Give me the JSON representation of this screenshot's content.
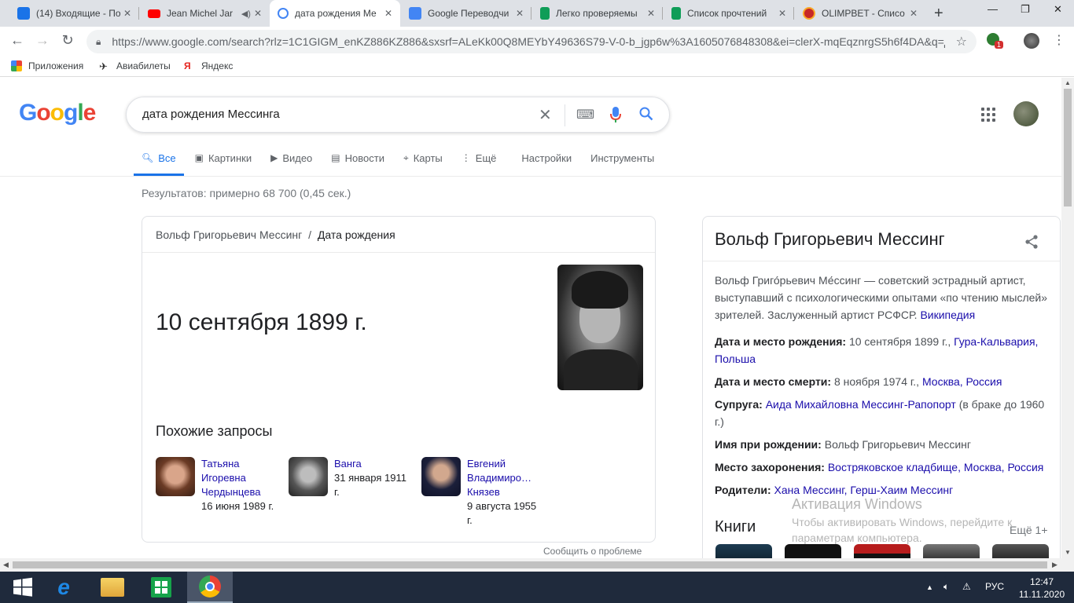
{
  "browser": {
    "tabs": [
      {
        "title": "(14) Входящие - По",
        "icon": "mail-icon",
        "color": "#1a73e8"
      },
      {
        "title": "Jean Michel Jar",
        "icon": "youtube-icon",
        "color": "#ff0000"
      },
      {
        "title": "дата рождения Ме",
        "icon": "google-icon",
        "color": "#4285f4"
      },
      {
        "title": "Google Переводчи",
        "icon": "translate-icon",
        "color": "#4285f4"
      },
      {
        "title": "Легко проверяемы",
        "icon": "sheets-icon",
        "color": "#0f9d58"
      },
      {
        "title": "Список прочтений",
        "icon": "sheets-icon",
        "color": "#0f9d58"
      },
      {
        "title": "OLIMPBET - Списо",
        "icon": "olimpbet-icon",
        "color": "#c62828"
      }
    ],
    "url": "https://www.google.com/search?rlz=1C1GIGM_enKZ886KZ886&sxsrf=ALeKk00Q8MEYbY49636S79-V-0-b_jgp6w%3A1605076848308&ei=clerX-mqEqznrgS5h6f4DA&q=д...",
    "extension_badge": "1",
    "bookmarks": [
      {
        "label": "Приложения",
        "icon": "apps-grid-icon"
      },
      {
        "label": "Авиабилеты",
        "icon": "airplane-icon"
      },
      {
        "label": "Яндекс",
        "icon": "yandex-icon"
      }
    ]
  },
  "google": {
    "logo": "Google",
    "query": "дата рождения Мессинга",
    "tabs": [
      {
        "label": "Все",
        "icon": "search-icon",
        "active": true
      },
      {
        "label": "Картинки",
        "icon": "image-icon"
      },
      {
        "label": "Видео",
        "icon": "video-icon"
      },
      {
        "label": "Новости",
        "icon": "news-icon"
      },
      {
        "label": "Карты",
        "icon": "map-pin-icon"
      },
      {
        "label": "Ещё",
        "icon": "more-vert-icon"
      },
      {
        "label": "Настройки"
      },
      {
        "label": "Инструменты"
      }
    ],
    "result_stats": "Результатов: примерно 68 700 (0,45 сек.)"
  },
  "featured": {
    "crumb_entity": "Вольф Григорьевич Мессинг",
    "crumb_sep": "/",
    "crumb_attr": "Дата рождения",
    "answer": "10 сентября 1899 г.",
    "related_title": "Похожие запросы",
    "related": [
      {
        "name": "Татьяна Игоревна Чердынцева",
        "date": "16 июня 1989 г."
      },
      {
        "name": "Ванга",
        "date": "31 января 1911 г."
      },
      {
        "name": "Евгений Владимиро… Князев",
        "date": "9 августа 1955 г."
      }
    ],
    "report": "Сообщить о проблеме"
  },
  "knowledge_panel": {
    "title": "Вольф Григорьевич Мессинг",
    "description": "Вольф Григо́рьевич Ме́ссинг — советский эстрадный артист, выступавший с психологическими опытами «по чтению мыслей» зрителей. Заслуженный артист РСФСР.",
    "source": "Википедия",
    "facts": {
      "birth_label": "Дата и место рождения:",
      "birth_value": "10 сентября 1899 г.,",
      "birth_place1": "Гура-Кальвария,",
      "birth_place2": "Польша",
      "death_label": "Дата и место смерти:",
      "death_value": "8 ноября 1974 г.,",
      "death_place1": "Москва,",
      "death_place2": "Россия",
      "spouse_label": "Супруга:",
      "spouse_value": "Аида Михайловна Мессинг-Рапопорт",
      "spouse_note": "(в браке до 1960 г.)",
      "birthname_label": "Имя при рождении:",
      "birthname_value": "Вольф Григорьевич Мессинг",
      "burial_label": "Место захоронения:",
      "burial_value1": "Востряковское кладбище,",
      "burial_value2": "Москва,",
      "burial_value3": "Россия",
      "parents_label": "Родители:",
      "parents_value1": "Хана Мессинг,",
      "parents_value2": "Герш-Хаим Мессинг"
    },
    "books_title": "Книги",
    "books_more": "Ещё 1+"
  },
  "windows": {
    "activation_title": "Активация Windows",
    "activation_line1": "Чтобы активировать Windows, перейдите к",
    "activation_line2": "параметрам компьютера.",
    "lang": "РУС",
    "time": "12:47",
    "date": "11.11.2020"
  }
}
